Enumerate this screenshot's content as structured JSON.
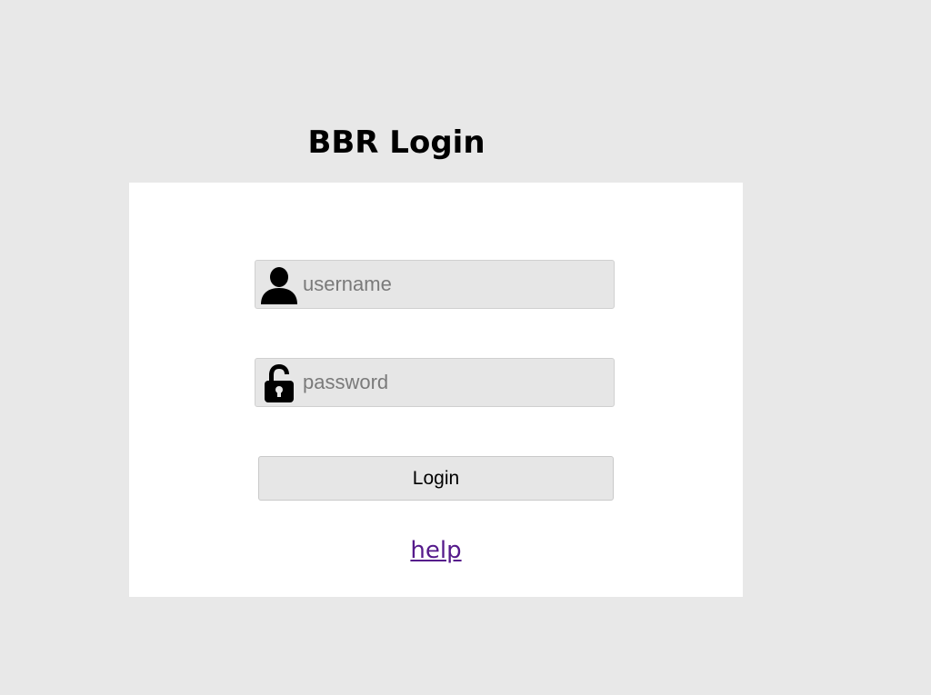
{
  "page": {
    "title": "BBR Login"
  },
  "form": {
    "username": {
      "placeholder": "username",
      "value": "",
      "icon": "user-icon"
    },
    "password": {
      "placeholder": "password",
      "value": "",
      "icon": "lock-icon"
    },
    "login_label": "Login",
    "help_label": "help"
  },
  "colors": {
    "background": "#e8e8e8",
    "card": "#ffffff",
    "field": "#e6e6e6",
    "link_visited": "#551a8b"
  }
}
